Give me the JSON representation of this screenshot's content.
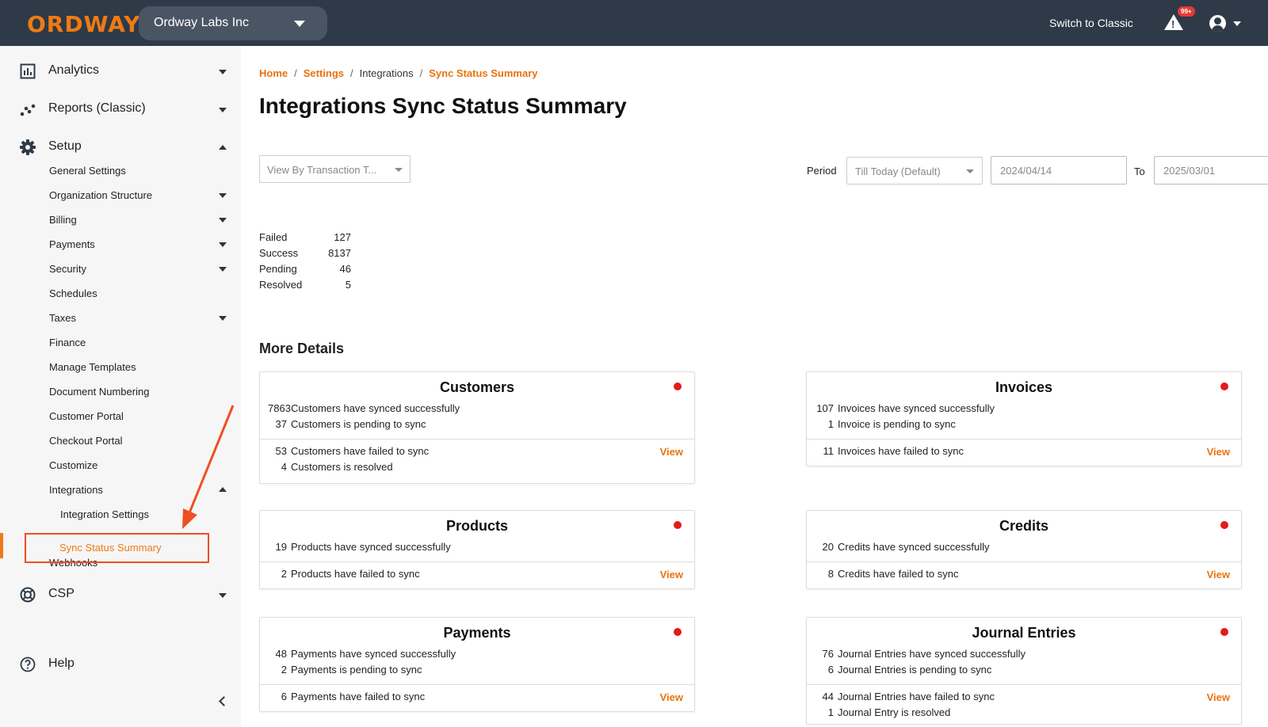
{
  "header": {
    "logo": "ORDWAY",
    "org_name": "Ordway Labs Inc",
    "switch_label": "Switch to Classic",
    "alert_badge": "99+"
  },
  "sidebar": {
    "analytics": "Analytics",
    "reports": "Reports (Classic)",
    "setup": "Setup",
    "setup_items": {
      "general_settings": "General Settings",
      "organization_structure": "Organization Structure",
      "billing": "Billing",
      "payments": "Payments",
      "security": "Security",
      "schedules": "Schedules",
      "taxes": "Taxes",
      "finance": "Finance",
      "manage_templates": "Manage Templates",
      "document_numbering": "Document Numbering",
      "customer_portal": "Customer Portal",
      "checkout_portal": "Checkout Portal",
      "customize": "Customize",
      "integrations": "Integrations",
      "integration_settings": "Integration Settings",
      "sync_status_summary": "Sync Status Summary",
      "webhooks": "Webhooks"
    },
    "csp": "CSP",
    "help": "Help"
  },
  "breadcrumb": {
    "home": "Home",
    "settings": "Settings",
    "integrations": "Integrations",
    "current": "Sync Status Summary",
    "sep": "/"
  },
  "page": {
    "title": "Integrations Sync Status Summary",
    "view_by_placeholder": "View By Transaction T...",
    "period_label": "Period",
    "period_value": "Till Today (Default)",
    "date_from": "2024/04/14",
    "to_label": "To",
    "date_to": "2025/03/01",
    "more_details": "More Details"
  },
  "summary": {
    "failed_label": "Failed",
    "failed_value": "127",
    "success_label": "Success",
    "success_value": "8137",
    "pending_label": "Pending",
    "pending_value": "46",
    "resolved_label": "Resolved",
    "resolved_value": "5"
  },
  "cards": {
    "customers": {
      "title": "Customers",
      "synced_n": "7863",
      "synced_t": "Customers have synced successfully",
      "pending_n": "37",
      "pending_t": "Customers is pending to sync",
      "failed_n": "53",
      "failed_t": "Customers have failed to sync",
      "resolved_n": "4",
      "resolved_t": "Customers is resolved",
      "view": "View"
    },
    "invoices": {
      "title": "Invoices",
      "synced_n": "107",
      "synced_t": "Invoices have synced successfully",
      "pending_n": "1",
      "pending_t": "Invoice is pending to sync",
      "failed_n": "11",
      "failed_t": "Invoices have failed to sync",
      "view": "View"
    },
    "products": {
      "title": "Products",
      "synced_n": "19",
      "synced_t": "Products have synced successfully",
      "failed_n": "2",
      "failed_t": "Products have failed to sync",
      "view": "View"
    },
    "credits": {
      "title": "Credits",
      "synced_n": "20",
      "synced_t": "Credits have synced successfully",
      "failed_n": "8",
      "failed_t": "Credits have failed to sync",
      "view": "View"
    },
    "payments": {
      "title": "Payments",
      "synced_n": "48",
      "synced_t": "Payments have synced successfully",
      "pending_n": "2",
      "pending_t": "Payments is pending to sync",
      "failed_n": "6",
      "failed_t": "Payments have failed to sync",
      "view": "View"
    },
    "journal": {
      "title": "Journal Entries",
      "synced_n": "76",
      "synced_t": "Journal Entries have synced successfully",
      "pending_n": "6",
      "pending_t": "Journal Entries is pending to sync",
      "failed_n": "44",
      "failed_t": "Journal Entries have failed to sync",
      "resolved_n": "1",
      "resolved_t": "Journal Entry is resolved",
      "view": "View"
    }
  },
  "colors": {
    "brand_orange": "#f07a14",
    "topbar": "#2e3a48",
    "status_red": "#e21b1b",
    "annotation_red": "#f04e23"
  }
}
